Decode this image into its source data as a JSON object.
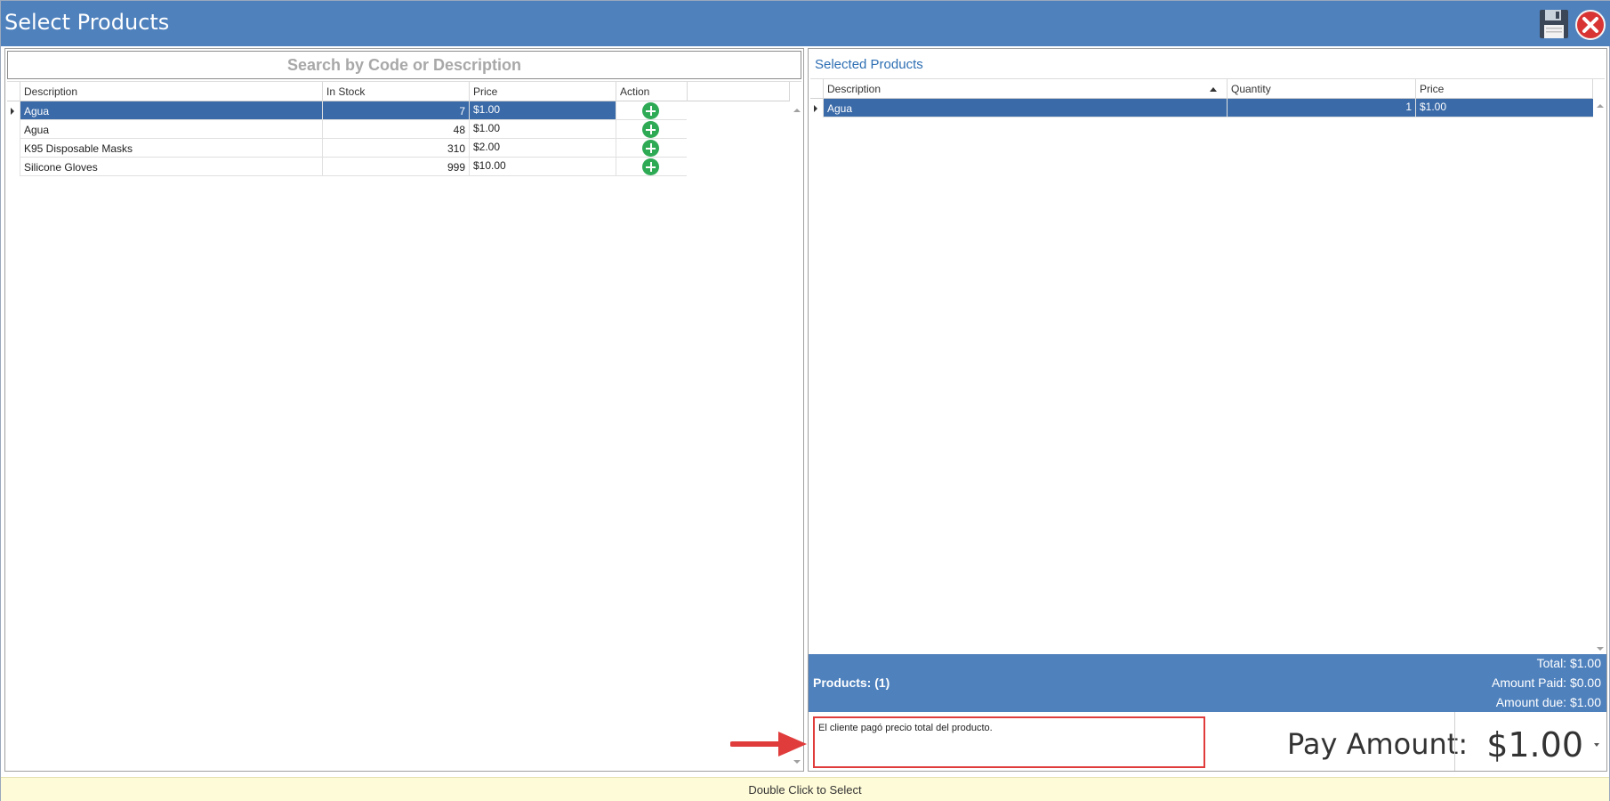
{
  "window": {
    "title": "Select Products"
  },
  "left": {
    "search": {
      "placeholder": "Search by Code or Description",
      "value": ""
    },
    "columns": [
      "Description",
      "In Stock",
      "Price",
      "Action"
    ],
    "rows": [
      {
        "description": "Agua",
        "in_stock": "7",
        "price": "$1.00",
        "selected": true
      },
      {
        "description": "Agua",
        "in_stock": "48",
        "price": "$1.00",
        "selected": false
      },
      {
        "description": "K95 Disposable Masks",
        "in_stock": "310",
        "price": "$2.00",
        "selected": false
      },
      {
        "description": "Silicone Gloves",
        "in_stock": "999",
        "price": "$10.00",
        "selected": false
      }
    ]
  },
  "right": {
    "title": "Selected Products",
    "columns": [
      "Description",
      "Quantity",
      "Price"
    ],
    "rows": [
      {
        "description": "Agua",
        "quantity": "1",
        "price": "$1.00",
        "selected": true
      }
    ],
    "summary": {
      "products": "Products: (1)",
      "total": "Total: $1.00",
      "amount_paid": "Amount Paid: $0.00",
      "amount_due": "Amount due: $1.00"
    },
    "note": "El cliente pagó precio total del producto.",
    "pay_label": "Pay Amount:",
    "pay_value": "$1.00"
  },
  "status": {
    "text": "Double Click to Select"
  },
  "colors": {
    "titlebar": "#4f81bd",
    "selection": "#3a6aa8",
    "add_icon": "#2eaa55",
    "highlight_box": "#e03c3c",
    "status_bg": "#fefbd8"
  },
  "icons": [
    "save-icon",
    "close-icon",
    "add-icon",
    "arrow-annotation"
  ]
}
